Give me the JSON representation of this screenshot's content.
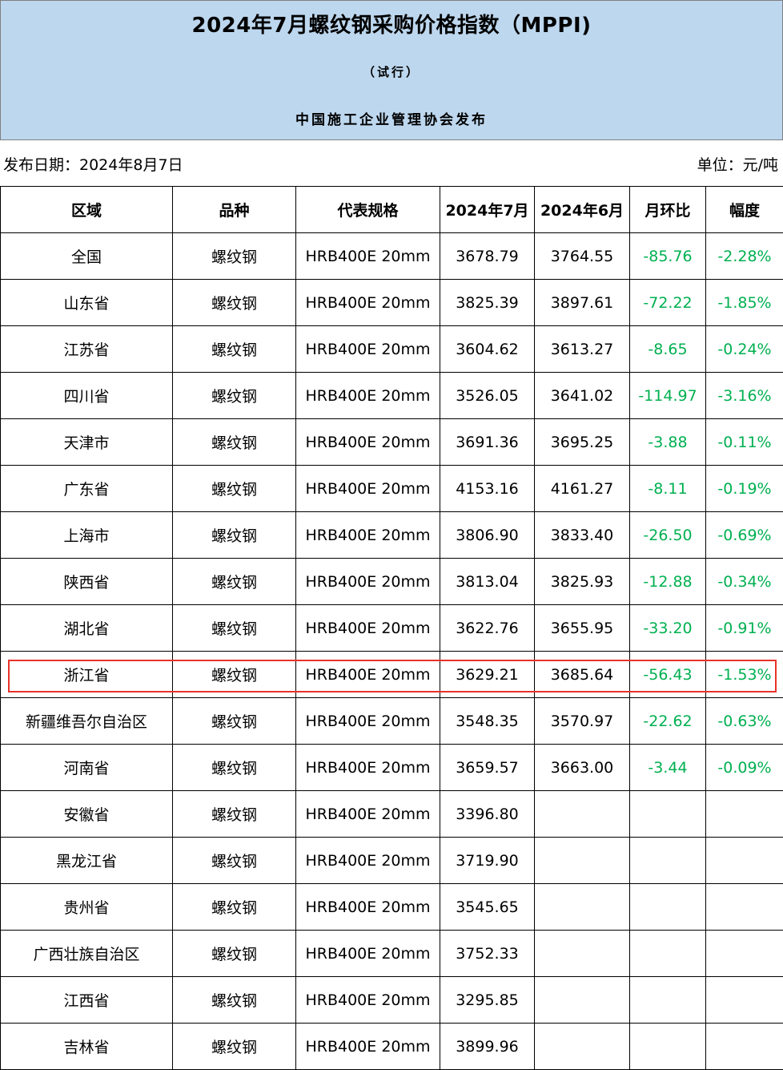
{
  "header": {
    "title": "2024年7月螺纹钢采购价格指数（MPPI)",
    "subtitle": "（试行）",
    "publisher": "中国施工企业管理协会发布"
  },
  "meta": {
    "release_date": "发布日期：2024年8月7日",
    "unit": "单位：元/吨"
  },
  "table": {
    "columns": [
      "区域",
      "品种",
      "代表规格",
      "2024年7月",
      "2024年6月",
      "月环比",
      "幅度"
    ],
    "rows": [
      {
        "region": "全国",
        "variety": "螺纹钢",
        "spec": "HRB400E 20mm",
        "jul": "3678.79",
        "jun": "3764.55",
        "mom": "-85.76",
        "pct": "-2.28%"
      },
      {
        "region": "山东省",
        "variety": "螺纹钢",
        "spec": "HRB400E 20mm",
        "jul": "3825.39",
        "jun": "3897.61",
        "mom": "-72.22",
        "pct": "-1.85%"
      },
      {
        "region": "江苏省",
        "variety": "螺纹钢",
        "spec": "HRB400E 20mm",
        "jul": "3604.62",
        "jun": "3613.27",
        "mom": "-8.65",
        "pct": "-0.24%"
      },
      {
        "region": "四川省",
        "variety": "螺纹钢",
        "spec": "HRB400E 20mm",
        "jul": "3526.05",
        "jun": "3641.02",
        "mom": "-114.97",
        "pct": "-3.16%"
      },
      {
        "region": "天津市",
        "variety": "螺纹钢",
        "spec": "HRB400E 20mm",
        "jul": "3691.36",
        "jun": "3695.25",
        "mom": "-3.88",
        "pct": "-0.11%"
      },
      {
        "region": "广东省",
        "variety": "螺纹钢",
        "spec": "HRB400E 20mm",
        "jul": "4153.16",
        "jun": "4161.27",
        "mom": "-8.11",
        "pct": "-0.19%"
      },
      {
        "region": "上海市",
        "variety": "螺纹钢",
        "spec": "HRB400E 20mm",
        "jul": "3806.90",
        "jun": "3833.40",
        "mom": "-26.50",
        "pct": "-0.69%"
      },
      {
        "region": "陕西省",
        "variety": "螺纹钢",
        "spec": "HRB400E 20mm",
        "jul": "3813.04",
        "jun": "3825.93",
        "mom": "-12.88",
        "pct": "-0.34%"
      },
      {
        "region": "湖北省",
        "variety": "螺纹钢",
        "spec": "HRB400E 20mm",
        "jul": "3622.76",
        "jun": "3655.95",
        "mom": "-33.20",
        "pct": "-0.91%"
      },
      {
        "region": "浙江省",
        "variety": "螺纹钢",
        "spec": "HRB400E 20mm",
        "jul": "3629.21",
        "jun": "3685.64",
        "mom": "-56.43",
        "pct": "-1.53%"
      },
      {
        "region": "新疆维吾尔自治区",
        "variety": "螺纹钢",
        "spec": "HRB400E 20mm",
        "jul": "3548.35",
        "jun": "3570.97",
        "mom": "-22.62",
        "pct": "-0.63%"
      },
      {
        "region": "河南省",
        "variety": "螺纹钢",
        "spec": "HRB400E 20mm",
        "jul": "3659.57",
        "jun": "3663.00",
        "mom": "-3.44",
        "pct": "-0.09%"
      },
      {
        "region": "安徽省",
        "variety": "螺纹钢",
        "spec": "HRB400E 20mm",
        "jul": "3396.80",
        "jun": "",
        "mom": "",
        "pct": ""
      },
      {
        "region": "黑龙江省",
        "variety": "螺纹钢",
        "spec": "HRB400E 20mm",
        "jul": "3719.90",
        "jun": "",
        "mom": "",
        "pct": ""
      },
      {
        "region": "贵州省",
        "variety": "螺纹钢",
        "spec": "HRB400E 20mm",
        "jul": "3545.65",
        "jun": "",
        "mom": "",
        "pct": ""
      },
      {
        "region": "广西壮族自治区",
        "variety": "螺纹钢",
        "spec": "HRB400E 20mm",
        "jul": "3752.33",
        "jun": "",
        "mom": "",
        "pct": ""
      },
      {
        "region": "江西省",
        "variety": "螺纹钢",
        "spec": "HRB400E 20mm",
        "jul": "3295.85",
        "jun": "",
        "mom": "",
        "pct": ""
      },
      {
        "region": "吉林省",
        "variety": "螺纹钢",
        "spec": "HRB400E 20mm",
        "jul": "3899.96",
        "jun": "",
        "mom": "",
        "pct": ""
      }
    ],
    "highlighted_region": "浙江省"
  },
  "colors": {
    "header_bg": "#bdd7ee",
    "negative_text": "#00b050",
    "highlight_border": "#e8332a"
  }
}
